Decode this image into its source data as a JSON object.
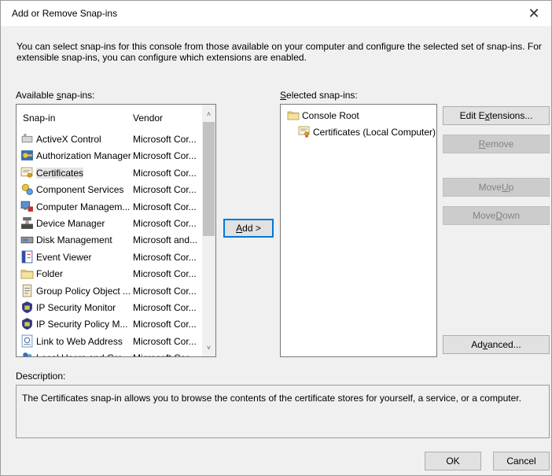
{
  "window": {
    "title": "Add or Remove Snap-ins",
    "close_glyph": "✕"
  },
  "intro_text": "You can select snap-ins for this console from those available on your computer and configure the selected set of snap-ins. For extensible snap-ins, you can configure which extensions are enabled.",
  "available": {
    "label_pre": "Available ",
    "label_u": "s",
    "label_post": "nap-ins:",
    "columns": {
      "snapin": "Snap-in",
      "vendor": "Vendor"
    },
    "rows": [
      {
        "name": "ActiveX Control",
        "vendor": "Microsoft Cor...",
        "icon": "activex-control-icon",
        "selected": false
      },
      {
        "name": "Authorization Manager",
        "vendor": "Microsoft Cor...",
        "icon": "authorization-manager-icon",
        "selected": false
      },
      {
        "name": "Certificates",
        "vendor": "Microsoft Cor...",
        "icon": "certificates-icon",
        "selected": true
      },
      {
        "name": "Component Services",
        "vendor": "Microsoft Cor...",
        "icon": "component-services-icon",
        "selected": false
      },
      {
        "name": "Computer Managem...",
        "vendor": "Microsoft Cor...",
        "icon": "computer-management-icon",
        "selected": false
      },
      {
        "name": "Device Manager",
        "vendor": "Microsoft Cor...",
        "icon": "device-manager-icon",
        "selected": false
      },
      {
        "name": "Disk Management",
        "vendor": "Microsoft and...",
        "icon": "disk-management-icon",
        "selected": false
      },
      {
        "name": "Event Viewer",
        "vendor": "Microsoft Cor...",
        "icon": "event-viewer-icon",
        "selected": false
      },
      {
        "name": "Folder",
        "vendor": "Microsoft Cor...",
        "icon": "folder-icon",
        "selected": false
      },
      {
        "name": "Group Policy Object ...",
        "vendor": "Microsoft Cor...",
        "icon": "group-policy-icon",
        "selected": false
      },
      {
        "name": "IP Security Monitor",
        "vendor": "Microsoft Cor...",
        "icon": "ip-security-monitor-icon",
        "selected": false
      },
      {
        "name": "IP Security Policy M...",
        "vendor": "Microsoft Cor...",
        "icon": "ip-security-policy-icon",
        "selected": false
      },
      {
        "name": "Link to Web Address",
        "vendor": "Microsoft Cor...",
        "icon": "link-web-address-icon",
        "selected": false
      },
      {
        "name": "Local Users and Gro...",
        "vendor": "Microsoft Cor...",
        "icon": "local-users-icon",
        "selected": false
      }
    ],
    "scroll_up_glyph": "˄",
    "scroll_down_glyph": "˅"
  },
  "add_button": {
    "label_pre": "",
    "label_u": "A",
    "label_post": "dd >"
  },
  "selected": {
    "label_pre": "S",
    "label_u": "e",
    "label_post": "lected snap-ins:",
    "root": {
      "label": "Console Root",
      "icon": "folder-icon"
    },
    "child": {
      "label": "Certificates (Local Computer)",
      "icon": "certificates-icon"
    }
  },
  "buttons": {
    "edit_extensions": {
      "pre": "Edit E",
      "u": "x",
      "post": "tensions..."
    },
    "remove": {
      "pre": "",
      "u": "R",
      "post": "emove"
    },
    "move_up": {
      "pre": "Move ",
      "u": "U",
      "post": "p"
    },
    "move_down": {
      "pre": "Move ",
      "u": "D",
      "post": "own"
    },
    "advanced": {
      "pre": "Ad",
      "u": "v",
      "post": "anced..."
    },
    "ok": "OK",
    "cancel": "Cancel"
  },
  "description": {
    "label": "Description:",
    "text": "The Certificates snap-in allows you to browse the contents of the certificate stores for yourself, a service, or a computer."
  },
  "colors": {
    "dialog_bg": "#f0f0f0",
    "list_bg": "#ffffff",
    "focus_border": "#0078d7",
    "disabled_text": "#838383"
  }
}
